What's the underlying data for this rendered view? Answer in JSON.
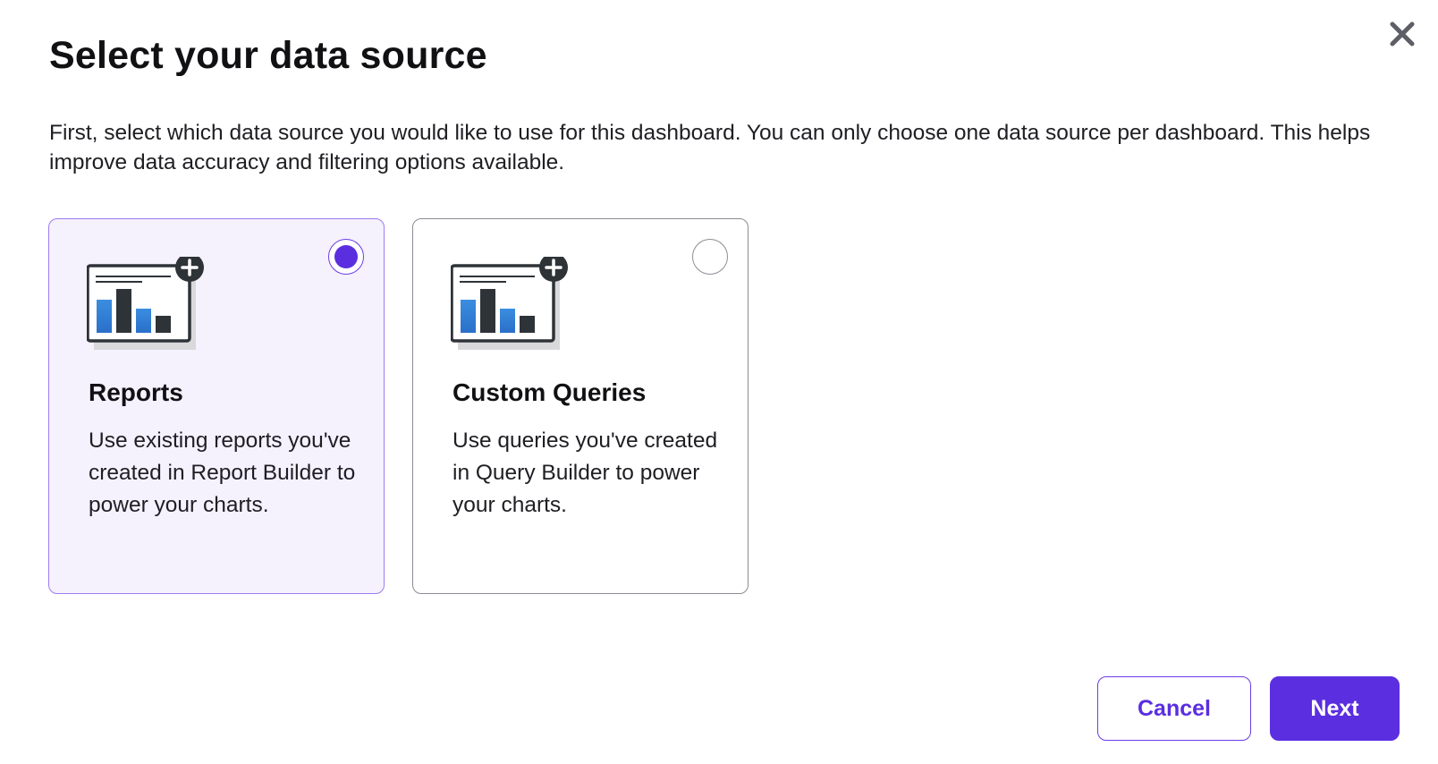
{
  "dialog": {
    "title": "Select your data source",
    "description": "First, select which data source you would like to use for this dashboard. You can only choose one data source per dashboard. This helps improve data accuracy and filtering options available.",
    "close_icon": "close-icon"
  },
  "options": [
    {
      "title": "Reports",
      "description": "Use existing reports you've created in Report Builder to power your charts.",
      "selected": true,
      "icon": "report-chart-add-icon"
    },
    {
      "title": "Custom Queries",
      "description": "Use queries you've created in Query Builder to power your charts.",
      "selected": false,
      "icon": "query-chart-add-icon"
    }
  ],
  "footer": {
    "cancel_label": "Cancel",
    "next_label": "Next"
  },
  "colors": {
    "accent": "#5b2ee0",
    "selected_card_bg": "#f5f1fd",
    "selected_card_border": "#9d7cf0",
    "chart_bar_blue": "#3b8ee0",
    "chart_bar_dark": "#2e3338"
  }
}
